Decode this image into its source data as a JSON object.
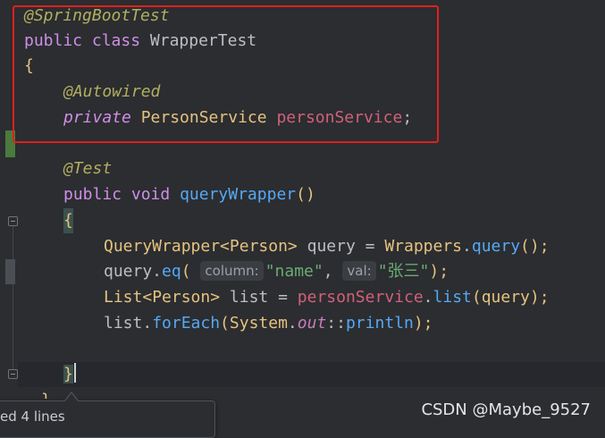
{
  "code": {
    "line1": {
      "annotation": "@SpringBootTest"
    },
    "line2": {
      "kw_public": "public",
      "kw_class": "class",
      "class_name": "WrapperTest"
    },
    "line3": {
      "brace": "{"
    },
    "line4": {
      "annotation": "@Autowired"
    },
    "line5": {
      "kw_private": "private",
      "type": "PersonService",
      "field": "personService",
      "semi": ";"
    },
    "line7": {
      "annotation": "@Test"
    },
    "line8": {
      "kw_public": "public",
      "kw_void": "void",
      "method": "queryWrapper",
      "parens": "()"
    },
    "line9": {
      "brace": "{"
    },
    "line10": {
      "type": "QueryWrapper",
      "generic_open": "<",
      "generic_type": "Person",
      "generic_close": ">",
      "var": " query = ",
      "cls": "Wrappers",
      "dot": ".",
      "method": "query",
      "tail": "();"
    },
    "line11": {
      "obj": "query.",
      "method": "eq",
      "open": "(",
      "hint1": "column:",
      "arg1": "\"name\"",
      "comma": ", ",
      "hint2": "val:",
      "arg2": "\"张三\"",
      "close": ");"
    },
    "line12": {
      "type": "List",
      "generic_open": "<",
      "generic_type": "Person",
      "generic_close": ">",
      "var": " list = ",
      "field": "personService",
      "dot": ".",
      "method": "list",
      "tail": "(query);"
    },
    "line13": {
      "obj": "list.",
      "method": "forEach",
      "open": "(",
      "cls": "System",
      "dot": ".",
      "static": "out",
      "sep": "::",
      "ref": "println",
      "tail": ");"
    },
    "line15": {
      "brace": "}"
    },
    "line16": {
      "brace": "}"
    }
  },
  "popup": {
    "text": "ed 4 lines"
  },
  "watermark": "CSDN @Maybe_9527",
  "colors": {
    "highlight_box": "#e0201d",
    "annotation": "#b3ae60",
    "keyword": "#cf8ee7",
    "field": "#d2607a",
    "method": "#56a8f5",
    "string": "#6aab73"
  }
}
